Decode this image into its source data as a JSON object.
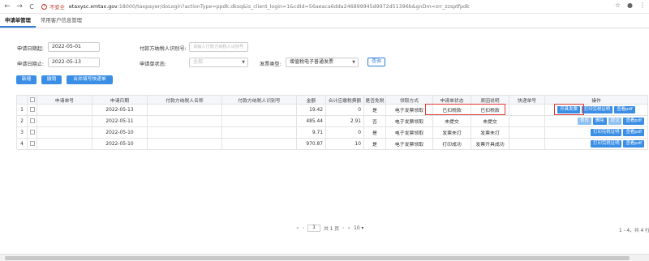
{
  "browser": {
    "back": "←",
    "forward": "→",
    "reload": "C",
    "insecure_label": "不安全",
    "url_host": "etaxysc.xmtax.gov",
    "url_path": ":18000/taxpayer/doLogin?actionType=ppdk.dksq&is_client_login=1&cdId=56aeaca6dda246899945d9972d51396b&gnDm=zrr_zzsptfpdk",
    "icons": [
      "star-icon",
      "account-icon",
      "menu-icon"
    ]
  },
  "tabs": [
    {
      "label": "申请单管理",
      "active": true
    },
    {
      "label": "常用客户信息管理",
      "active": false
    }
  ],
  "form": {
    "start_date_label": "申请日期起:",
    "start_date": "2022-05-01",
    "end_date_label": "申请日期止:",
    "end_date": "2022-05-13",
    "buyer_id_label": "付款方纳税人识别号:",
    "buyer_id_placeholder": "请输入付款方纳税人识别号",
    "status_label": "申请单状态:",
    "status_value": "全部",
    "invoice_type_label": "发票类型:",
    "invoice_type_value": "增值税电子普通发票",
    "query_button": "查询"
  },
  "actions": {
    "add": "新增",
    "cancel": "撤销",
    "merge": "合并填写快递单"
  },
  "table": {
    "headers": [
      "",
      "申请单号",
      "申请日期",
      "付款方纳税人名称",
      "付款方纳税人识别号",
      "金额",
      "合计应缴税费额",
      "是否免税",
      "领取方式",
      "申请单状态",
      "原因说明",
      "快递单号",
      "操作"
    ],
    "rows": [
      {
        "no": "1",
        "date": "2022-05-13",
        "amount": "19.42",
        "tax": "0",
        "exempt": "是",
        "method": "电子发票领取",
        "status": "已扣税款",
        "reason": "已扣税款",
        "ops": [
          "开具发票",
          "打印完税证明",
          "查看pdf"
        ]
      },
      {
        "no": "2",
        "date": "2022-05-11",
        "amount": "485.44",
        "tax": "2.91",
        "exempt": "否",
        "method": "电子发票领取",
        "status": "未提交",
        "reason": "未提交",
        "ops": [
          "修改",
          "删除",
          "提交",
          "查看pdf"
        ]
      },
      {
        "no": "3",
        "date": "2022-05-10",
        "amount": "9.71",
        "tax": "0",
        "exempt": "是",
        "method": "电子发票领取",
        "status": "发票未打",
        "reason": "发票未打",
        "ops": [
          "打印完税证明",
          "查看pdf"
        ]
      },
      {
        "no": "4",
        "date": "2022-05-10",
        "amount": "970.87",
        "tax": "10",
        "exempt": "是",
        "method": "电子发票领取",
        "status": "打印成功",
        "reason": "发票开具成功",
        "ops": [
          "打印完税证明",
          "查看pdf"
        ]
      }
    ]
  },
  "pagination": {
    "first": "«",
    "prev": "‹",
    "page": "1",
    "total_pages": "共 1 页",
    "next": "›",
    "last": "»",
    "page_size": "10",
    "range": "1 - 4，共 4 行"
  },
  "colors": {
    "accent": "#3a8ee6",
    "highlight": "#e53935"
  }
}
